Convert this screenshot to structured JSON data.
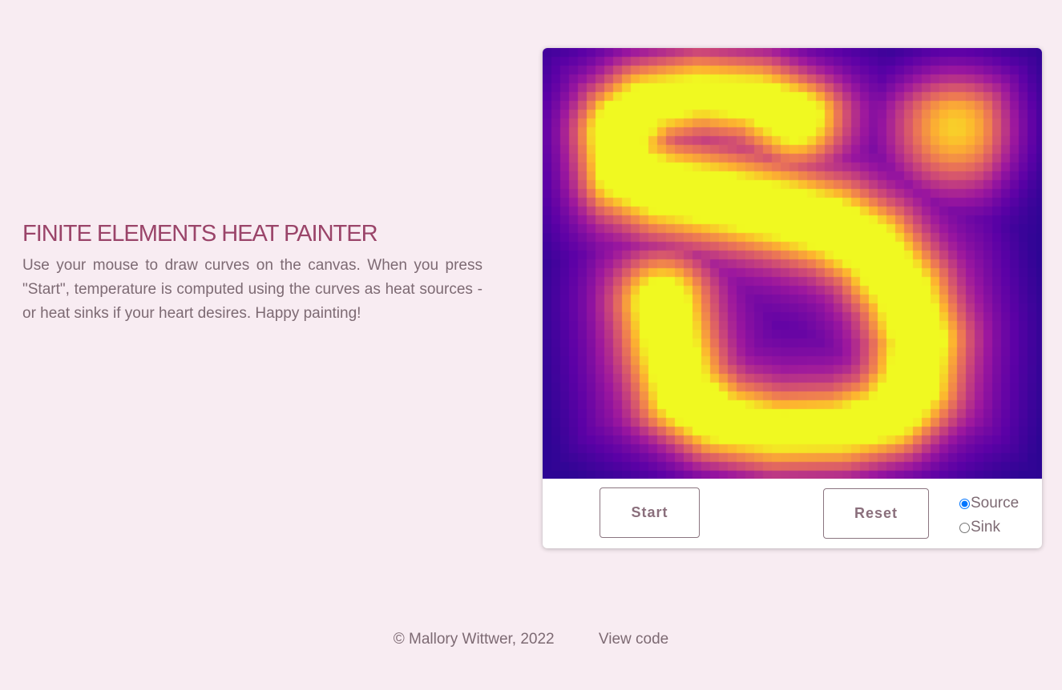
{
  "intro": {
    "title": "FINITE ELEMENTS HEAT PAINTER",
    "description": "Use your mouse to draw curves on the canvas. When you press \"Start\", temperature is computed using the curves as heat sources - or heat sinks if your heart desires. Happy painting!"
  },
  "controls": {
    "start_label": "Start",
    "reset_label": "Reset",
    "mode_options": [
      "Source",
      "Sink"
    ],
    "selected_mode": "Source"
  },
  "footer": {
    "copyright": "© Mallory Wittwer, 2022",
    "code_link": "View code"
  },
  "colors": {
    "background": "#f8ecf2",
    "title": "#9a4469",
    "text": "#7d6a73",
    "colormap": [
      "#0d0887",
      "#5c01a6",
      "#9c179e",
      "#cc4778",
      "#ed7953",
      "#fdb42f",
      "#f0f921"
    ]
  }
}
